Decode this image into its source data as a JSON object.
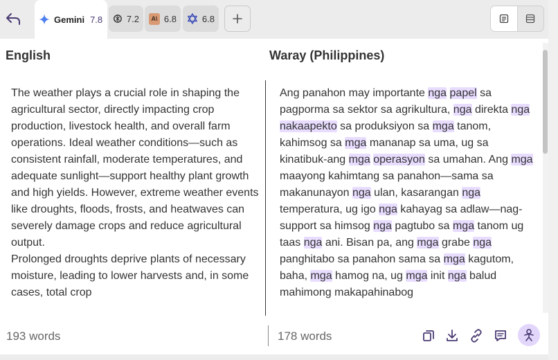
{
  "tabs": [
    {
      "name": "Gemini",
      "score": "7.8"
    },
    {
      "name": "",
      "score": "7.2"
    },
    {
      "name": "",
      "score": "6.8"
    },
    {
      "name": "",
      "score": "6.8"
    }
  ],
  "left": {
    "title": "English",
    "paragraphs": [
      "The weather plays a crucial role in shaping the agricultural sector, directly impacting crop production, livestock health, and overall farm operations. Ideal weather conditions—such as consistent rainfall, moderate temperatures, and adequate sunlight—support healthy plant growth and high yields. However, extreme weather events like droughts, floods, frosts, and heatwaves can severely damage crops and reduce agricultural output.",
      "Prolonged droughts deprive plants of necessary moisture, leading to lower harvests and, in some cases, total crop"
    ],
    "word_count": "193 words"
  },
  "right": {
    "title": "Waray (Philippines)",
    "segments": [
      {
        "t": "Ang panahon may importante ",
        "h": false
      },
      {
        "t": "nga",
        "h": true
      },
      {
        "t": " ",
        "h": false
      },
      {
        "t": "papel",
        "h": true
      },
      {
        "t": " sa pagporma sa sektor sa agrikultura, ",
        "h": false
      },
      {
        "t": "nga",
        "h": true
      },
      {
        "t": " direkta ",
        "h": false
      },
      {
        "t": "nga",
        "h": true
      },
      {
        "t": " ",
        "h": false
      },
      {
        "t": "nakaapekto",
        "h": true
      },
      {
        "t": " sa produksiyon sa ",
        "h": false
      },
      {
        "t": "mga",
        "h": true
      },
      {
        "t": " tanom, kahimsog sa ",
        "h": false
      },
      {
        "t": "mga",
        "h": true
      },
      {
        "t": " mananap sa uma, ug sa kinatibuk-ang ",
        "h": false
      },
      {
        "t": "mga",
        "h": true
      },
      {
        "t": " ",
        "h": false
      },
      {
        "t": "operasyon",
        "h": true
      },
      {
        "t": " sa umahan. Ang ",
        "h": false
      },
      {
        "t": "mga",
        "h": true
      },
      {
        "t": " maayong kahimtang sa panahon—sama sa makanunayon ",
        "h": false
      },
      {
        "t": "nga",
        "h": true
      },
      {
        "t": " ulan, kasarangan ",
        "h": false
      },
      {
        "t": "nga",
        "h": true
      },
      {
        "t": " temperatura, ug igo ",
        "h": false
      },
      {
        "t": "nga",
        "h": true
      },
      {
        "t": " kahayag sa adlaw—nag-support sa himsog ",
        "h": false
      },
      {
        "t": "nga",
        "h": true
      },
      {
        "t": " pagtubo sa ",
        "h": false
      },
      {
        "t": "mga",
        "h": true
      },
      {
        "t": " tanom ug taas ",
        "h": false
      },
      {
        "t": "nga",
        "h": true
      },
      {
        "t": " ani. Bisan pa, ang ",
        "h": false
      },
      {
        "t": "mga",
        "h": true
      },
      {
        "t": " grabe ",
        "h": false
      },
      {
        "t": "nga",
        "h": true
      },
      {
        "t": " panghitabo sa panahon sama sa ",
        "h": false
      },
      {
        "t": "mga",
        "h": true
      },
      {
        "t": " kagutom, baha, ",
        "h": false
      },
      {
        "t": "mga",
        "h": true
      },
      {
        "t": " hamog na, ug ",
        "h": false
      },
      {
        "t": "mga",
        "h": true
      },
      {
        "t": " init ",
        "h": false
      },
      {
        "t": "nga",
        "h": true
      },
      {
        "t": " balud mahimong makapahinabog",
        "h": false
      }
    ],
    "word_count": "178 words"
  },
  "colors": {
    "accent": "#4a3a73",
    "highlight": "#e8dcff"
  },
  "icons": [
    "back-arrow-icon",
    "gemini-icon",
    "openai-icon",
    "anthropic-icon",
    "model-icon",
    "plus-icon",
    "document-view-icon",
    "split-view-icon",
    "copy-icon",
    "download-icon",
    "link-icon",
    "comment-icon",
    "ai-assistant-icon"
  ]
}
